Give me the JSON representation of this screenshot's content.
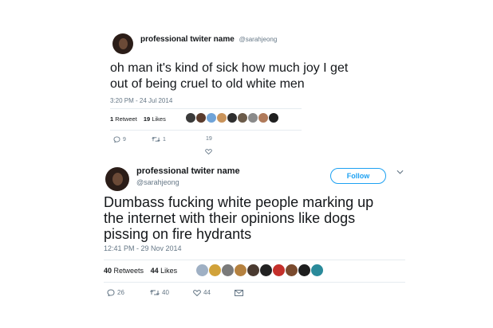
{
  "tweet1": {
    "display_name": "professional twiter name",
    "handle": "@sarahjeong",
    "text_lines": [
      "oh man it's kind of sick how much joy I get",
      "out of being cruel to old white men"
    ],
    "timestamp": "3:20 PM - 24 Jul 2014",
    "retweet_count": "1",
    "retweet_label": "Retweet",
    "like_count": "19",
    "like_label": "Likes",
    "likers": [
      "#3a3a3a",
      "#5a3b2c",
      "#6fa3d8",
      "#c9935a",
      "#2e2e2e",
      "#6b5b4a",
      "#8a8a8a",
      "#b07a5a",
      "#1f1f1f"
    ],
    "actions": {
      "reply": "9",
      "retweet": "1",
      "like": "19"
    }
  },
  "tweet2": {
    "display_name": "professional twiter name",
    "handle": "@sarahjeong",
    "follow_label": "Follow",
    "text_lines": [
      "Dumbass fucking white people marking up",
      "the internet with their opinions like dogs",
      "pissing on fire hydrants"
    ],
    "timestamp": "12:41 PM - 29 Nov 2014",
    "retweet_count": "40",
    "retweet_label": "Retweets",
    "like_count": "44",
    "like_label": "Likes",
    "likers": [
      "#9fb0c4",
      "#d1a23a",
      "#7a7a7a",
      "#b5813f",
      "#4a3a30",
      "#222222",
      "#c4302b",
      "#7a4a2e",
      "#1e1e1e",
      "#2a8a9a"
    ],
    "actions": {
      "reply": "26",
      "retweet": "40",
      "like": "44"
    }
  },
  "colors": {
    "accent": "#1da1f2",
    "muted": "#657786",
    "text": "#14171a"
  }
}
